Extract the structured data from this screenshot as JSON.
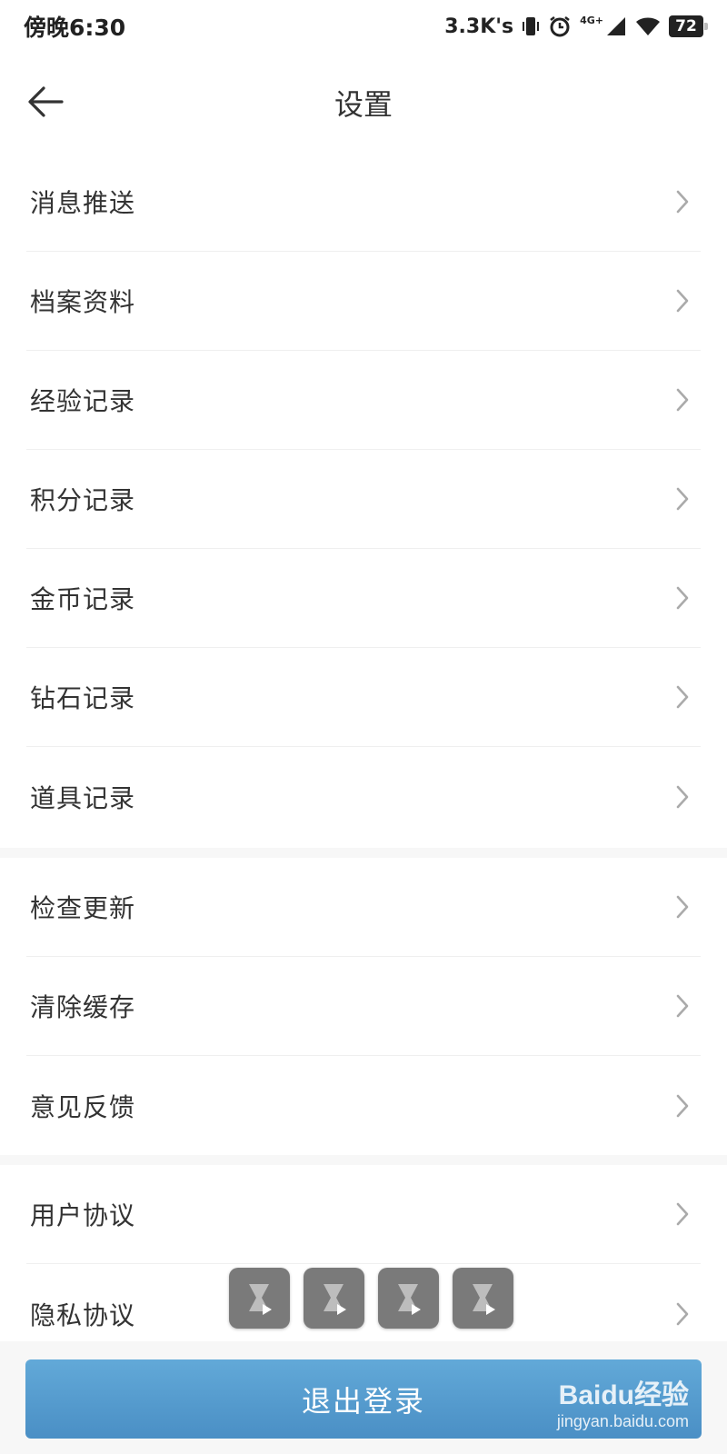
{
  "status_bar": {
    "time": "傍晚6:30",
    "net_speed": "3.3K's",
    "network_label": "4G+",
    "battery": "72"
  },
  "header": {
    "title": "设置"
  },
  "groups": [
    {
      "items": [
        {
          "label": "消息推送"
        },
        {
          "label": "档案资料"
        },
        {
          "label": "经验记录"
        },
        {
          "label": "积分记录"
        },
        {
          "label": "金币记录"
        },
        {
          "label": "钻石记录"
        },
        {
          "label": "道具记录"
        }
      ]
    },
    {
      "items": [
        {
          "label": "检查更新"
        },
        {
          "label": "清除缓存"
        },
        {
          "label": "意见反馈"
        }
      ]
    },
    {
      "items": [
        {
          "label": "用户协议"
        },
        {
          "label": "隐私协议"
        }
      ]
    }
  ],
  "logout_label": "退出登录",
  "watermark": {
    "logo": "Baidu经验",
    "url": "jingyan.baidu.com"
  },
  "colors": {
    "accent": "#5299cd",
    "background_gap": "#f7f7f7",
    "text": "#333333"
  }
}
